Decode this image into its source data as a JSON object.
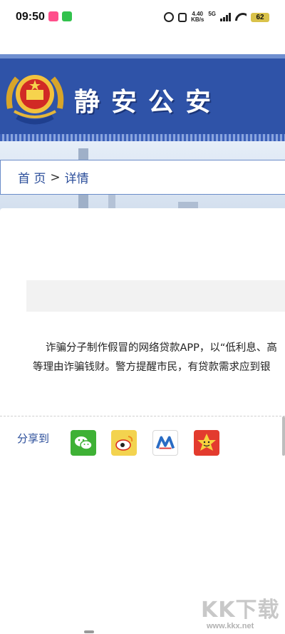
{
  "status_bar": {
    "time": "09:50",
    "net_speed_value": "4.40",
    "net_speed_unit": "KB/s",
    "network": "5G",
    "battery": "62"
  },
  "header": {
    "title": "静安公安",
    "brand_color": "#2f53a8"
  },
  "breadcrumb": {
    "home": "首 页",
    "separator": ">",
    "current": "详情"
  },
  "article": {
    "line1": "诈骗分子制作假冒的网络贷款APP，以“低利息、高",
    "line2": "等理由诈骗钱财。警方提醒市民，有贷款需求应到银"
  },
  "share": {
    "label": "分享到",
    "targets": [
      {
        "name": "wechat",
        "icon": "wechat-icon",
        "color": "#3eb135"
      },
      {
        "name": "weibo",
        "icon": "weibo-icon",
        "color": "#f3d34f"
      },
      {
        "name": "renren",
        "icon": "renren-icon",
        "color": "#2a6cc4"
      },
      {
        "name": "qzone",
        "icon": "qzone-icon",
        "color": "#e33b2e"
      }
    ]
  },
  "watermark": {
    "brand": "KK下载",
    "url": "www.kkx.net"
  }
}
